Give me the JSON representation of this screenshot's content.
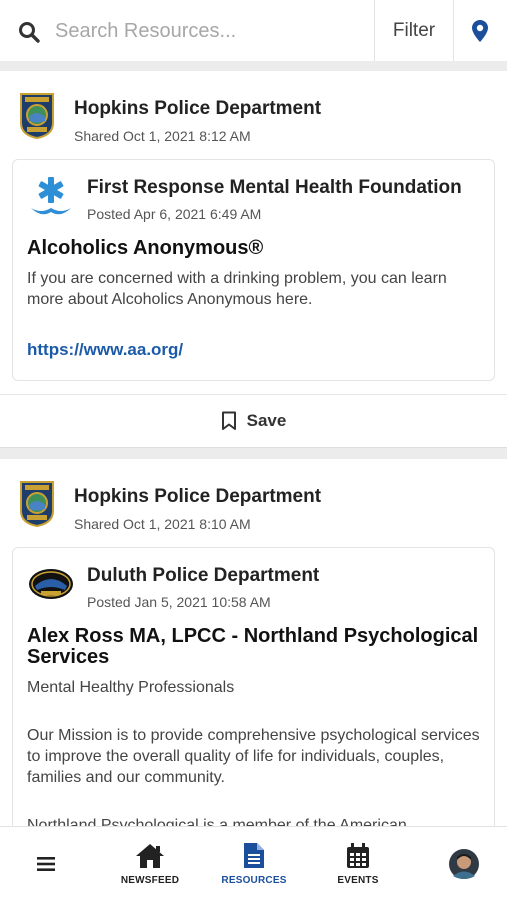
{
  "search": {
    "placeholder": "Search Resources..."
  },
  "toolbar": {
    "filter_label": "Filter"
  },
  "posts": [
    {
      "poster": "Hopkins Police Department",
      "shared": "Shared Oct 1, 2021 8:12 AM",
      "card": {
        "org": "First Response Mental Health Foundation",
        "posted": "Posted Apr 6, 2021 6:49 AM",
        "title": "Alcoholics Anonymous®",
        "text": "If you are concerned with a drinking problem, you can learn more about Alcoholics Anonymous here.",
        "link": "https://www.aa.org/"
      },
      "save_label": "Save"
    },
    {
      "poster": "Hopkins Police Department",
      "shared": "Shared Oct 1, 2021 8:10 AM",
      "card": {
        "org": "Duluth Police Department",
        "posted": "Posted Jan 5, 2021 10:58 AM",
        "title": "Alex Ross MA, LPCC - Northland Psychological Services",
        "subtitle": "Mental Healthy Professionals",
        "text1": "Our Mission is to provide comprehensive psychological services to improve the overall quality of life for individuals, couples, families and our community.",
        "text2": "Northland Psychological is a member of the American"
      }
    }
  ],
  "nav": {
    "newsfeed": "NEWSFEED",
    "resources": "RESOURCES",
    "events": "EVENTS"
  },
  "colors": {
    "accent": "#1b4f9c",
    "link": "#1b5aa8"
  }
}
